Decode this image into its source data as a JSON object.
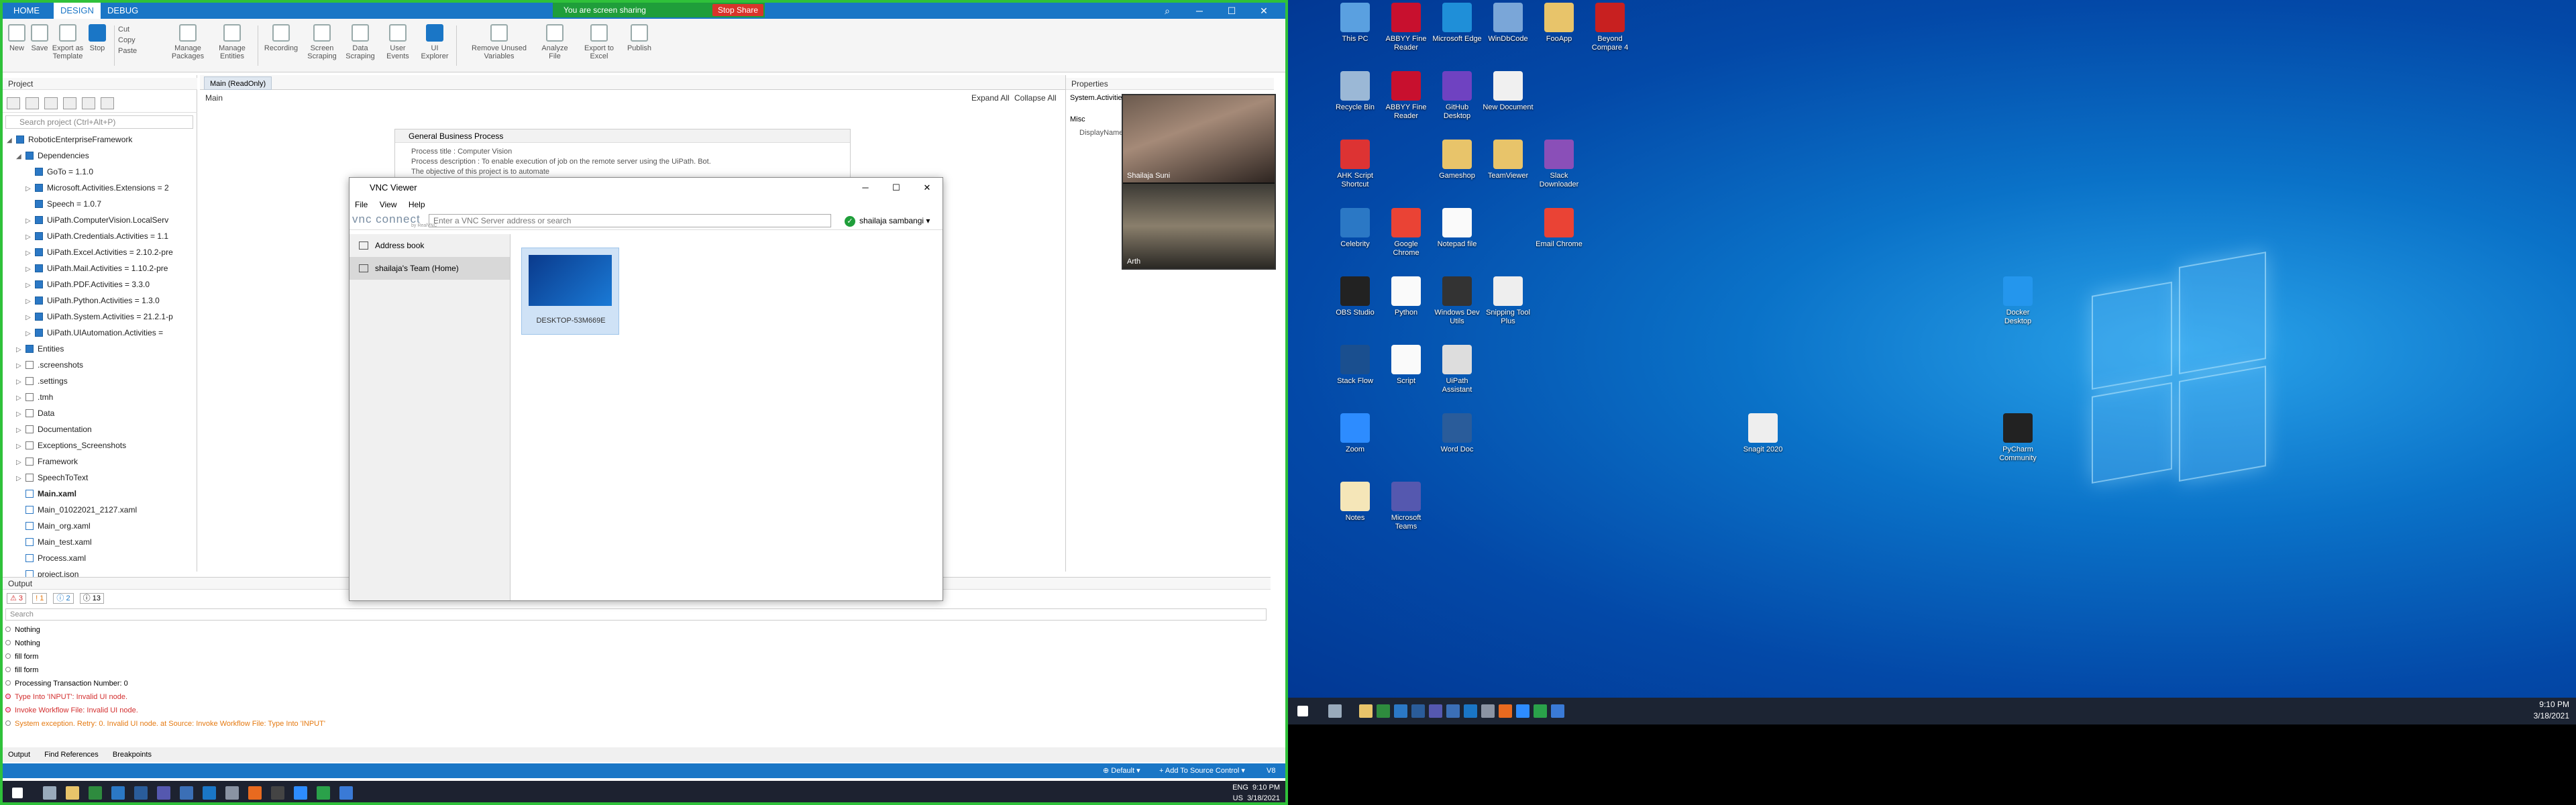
{
  "share": {
    "text": "You are screen sharing",
    "stop": "Stop Share"
  },
  "studio": {
    "tabs": [
      "HOME",
      "DESIGN",
      "DEBUG"
    ],
    "ribbon": [
      "New",
      "Save",
      "Export as Template",
      "Stop",
      "Cut",
      "Copy",
      "Paste",
      "Manage Packages",
      "Manage Entities",
      "Recording",
      "Screen Scraping",
      "Data Scraping",
      "User Events",
      "UI Explorer",
      "Remove Unused Variables",
      "Analyze File",
      "Export to Excel",
      "Publish"
    ],
    "project": {
      "title": "Project",
      "search": "Search project (Ctrl+Alt+P)",
      "tree": [
        {
          "label": "RoboticEnterpriseFramework",
          "level": 0,
          "type": "root",
          "exp": "◢"
        },
        {
          "label": "Dependencies",
          "level": 1,
          "type": "root",
          "exp": "◢"
        },
        {
          "label": "GoTo = 1.1.0",
          "level": 2,
          "type": "pkg",
          "exp": ""
        },
        {
          "label": "Microsoft.Activities.Extensions = 2",
          "level": 2,
          "type": "pkg",
          "exp": "▷"
        },
        {
          "label": "Speech = 1.0.7",
          "level": 2,
          "type": "pkg",
          "exp": ""
        },
        {
          "label": "UiPath.ComputerVision.LocalServ",
          "level": 2,
          "type": "pkg",
          "exp": "▷"
        },
        {
          "label": "UiPath.Credentials.Activities = 1.1",
          "level": 2,
          "type": "pkg",
          "exp": "▷"
        },
        {
          "label": "UiPath.Excel.Activities = 2.10.2-pre",
          "level": 2,
          "type": "pkg",
          "exp": "▷"
        },
        {
          "label": "UiPath.Mail.Activities = 1.10.2-pre",
          "level": 2,
          "type": "pkg",
          "exp": "▷"
        },
        {
          "label": "UiPath.PDF.Activities = 3.3.0",
          "level": 2,
          "type": "pkg",
          "exp": "▷"
        },
        {
          "label": "UiPath.Python.Activities = 1.3.0",
          "level": 2,
          "type": "pkg",
          "exp": "▷"
        },
        {
          "label": "UiPath.System.Activities = 21.2.1-p",
          "level": 2,
          "type": "pkg",
          "exp": "▷"
        },
        {
          "label": "UiPath.UIAutomation.Activities =",
          "level": 2,
          "type": "pkg",
          "exp": "▷"
        },
        {
          "label": "Entities",
          "level": 1,
          "type": "pkg",
          "exp": "▷"
        },
        {
          "label": ".screenshots",
          "level": 1,
          "type": "folder",
          "exp": "▷"
        },
        {
          "label": ".settings",
          "level": 1,
          "type": "folder",
          "exp": "▷"
        },
        {
          "label": ".tmh",
          "level": 1,
          "type": "folder",
          "exp": "▷"
        },
        {
          "label": "Data",
          "level": 1,
          "type": "folder",
          "exp": "▷"
        },
        {
          "label": "Documentation",
          "level": 1,
          "type": "folder",
          "exp": "▷"
        },
        {
          "label": "Exceptions_Screenshots",
          "level": 1,
          "type": "folder",
          "exp": "▷"
        },
        {
          "label": "Framework",
          "level": 1,
          "type": "folder",
          "exp": "▷"
        },
        {
          "label": "SpeechToText",
          "level": 1,
          "type": "folder",
          "exp": "▷"
        },
        {
          "label": "Main.xaml",
          "level": 1,
          "type": "file",
          "exp": "",
          "bold": true
        },
        {
          "label": "Main_01022021_2127.xaml",
          "level": 1,
          "type": "file",
          "exp": ""
        },
        {
          "label": "Main_org.xaml",
          "level": 1,
          "type": "file",
          "exp": ""
        },
        {
          "label": "Main_test.xaml",
          "level": 1,
          "type": "file",
          "exp": ""
        },
        {
          "label": "Process.xaml",
          "level": 1,
          "type": "file",
          "exp": ""
        },
        {
          "label": "project.json",
          "level": 1,
          "type": "file",
          "exp": ""
        }
      ]
    },
    "designer": {
      "tab": "Main (ReadOnly)",
      "breadcrumb": "Main",
      "expand": "Expand All",
      "collapse": "Collapse All",
      "activity_title": "General Business Process",
      "lines": [
        "Process title : Computer Vision",
        "Process description : To enable execution of job on the remote server using the UiPath. Bot.",
        "The objective of this project is to automate"
      ]
    },
    "properties": {
      "title": "Properties",
      "type": "System.Activities",
      "misc": "Misc",
      "display": "DisplayName"
    },
    "output": {
      "title": "Output",
      "errors": "⚠ 3",
      "warnings": "! 1",
      "info": "ⓘ 2",
      "trace": "ⓘ 13",
      "search": "Search",
      "lines": [
        {
          "text": "Nothing",
          "kind": "info"
        },
        {
          "text": "Nothing",
          "kind": "info"
        },
        {
          "text": "fill form",
          "kind": "info"
        },
        {
          "text": "fill form",
          "kind": "info"
        },
        {
          "text": "Processing Transaction Number: 0",
          "kind": "info"
        },
        {
          "text": "Type Into 'INPUT': Invalid UI node.",
          "kind": "err"
        },
        {
          "text": "Invoke Workflow File: Invalid UI node.",
          "kind": "err"
        },
        {
          "text": "System exception. Retry: 0. Invalid UI node. at Source: Invoke Workflow File: Type Into 'INPUT'",
          "kind": "warn"
        }
      ]
    },
    "bottom": [
      "Output",
      "Find References",
      "Breakpoints"
    ],
    "status": {
      "profile": "⊕ Default ▾",
      "source": "+ Add To Source Control ▾",
      "version": "V8"
    }
  },
  "vnc": {
    "title": "VNC Viewer",
    "menu": [
      "File",
      "View",
      "Help"
    ],
    "logo": "vnc connect",
    "logo_sub": "by RealVNC",
    "address_placeholder": "Enter a VNC Server address or search",
    "user": "shailaja sambangi",
    "side": [
      "Address book",
      "shailaja's Team (Home)"
    ],
    "computer": "DESKTOP-53M669E"
  },
  "zoom": {
    "p1": "Shailaja Suni",
    "p2": "Arth"
  },
  "desktop": {
    "icons": [
      {
        "label": "This PC",
        "color": "#5aa0e0",
        "col": 0,
        "row": 0
      },
      {
        "label": "ABBYY Fine Reader",
        "color": "#c8102e",
        "col": 1,
        "row": 0
      },
      {
        "label": "Microsoft Edge",
        "color": "#1f8fd8",
        "col": 2,
        "row": 0
      },
      {
        "label": "WinDbCode",
        "color": "#7aa6d8",
        "col": 3,
        "row": 0
      },
      {
        "label": "FooApp",
        "color": "#e8c46a",
        "col": 4,
        "row": 0
      },
      {
        "label": "Beyond Compare 4",
        "color": "#c82020",
        "col": 5,
        "row": 0
      },
      {
        "label": "Recycle Bin",
        "color": "#9bb8d6",
        "col": 0,
        "row": 1
      },
      {
        "label": "ABBYY Fine Reader",
        "color": "#c8102e",
        "col": 1,
        "row": 1
      },
      {
        "label": "GitHub Desktop",
        "color": "#6f42c1",
        "col": 2,
        "row": 1
      },
      {
        "label": "New Document",
        "color": "#f0f0f0",
        "col": 3,
        "row": 1
      },
      {
        "label": "AHK Script Shortcut",
        "color": "#d33",
        "col": 0,
        "row": 2
      },
      {
        "label": "Gameshop",
        "color": "#e8c46a",
        "col": 2,
        "row": 2
      },
      {
        "label": "TeamViewer",
        "color": "#e8c46a",
        "col": 3,
        "row": 2
      },
      {
        "label": "Slack Downloader",
        "color": "#8a4fb8",
        "col": 4,
        "row": 2
      },
      {
        "label": "Celebrity",
        "color": "#2b78c5",
        "col": 0,
        "row": 3
      },
      {
        "label": "Google Chrome",
        "color": "#ea4335",
        "col": 1,
        "row": 3
      },
      {
        "label": "Notepad file",
        "color": "#fafafa",
        "col": 2,
        "row": 3
      },
      {
        "label": "Email Chrome",
        "color": "#ea4335",
        "col": 4,
        "row": 3
      },
      {
        "label": "OBS Studio",
        "color": "#222",
        "col": 0,
        "row": 4
      },
      {
        "label": "Python",
        "color": "#fafafa",
        "col": 1,
        "row": 4
      },
      {
        "label": "Windows Dev Utils",
        "color": "#333",
        "col": 2,
        "row": 4
      },
      {
        "label": "Snipping Tool Plus",
        "color": "#eee",
        "col": 3,
        "row": 4
      },
      {
        "label": "Stack Flow",
        "color": "#1a4f8f",
        "col": 0,
        "row": 5
      },
      {
        "label": "Script",
        "color": "#fafafa",
        "col": 1,
        "row": 5
      },
      {
        "label": "UiPath Assistant",
        "color": "#ddd",
        "col": 2,
        "row": 5
      },
      {
        "label": "Zoom",
        "color": "#2d8cff",
        "col": 0,
        "row": 6
      },
      {
        "label": "Word Doc",
        "color": "#2a5c9a",
        "col": 2,
        "row": 6
      },
      {
        "label": "Notes",
        "color": "#f5e6b8",
        "col": 0,
        "row": 7
      },
      {
        "label": "Microsoft Teams",
        "color": "#5558af",
        "col": 1,
        "row": 7
      },
      {
        "label": "Docker Desktop",
        "color": "#2496ed",
        "col": 13,
        "row": 4
      },
      {
        "label": "Snagit 2020",
        "color": "#eee",
        "col": 8,
        "row": 6
      },
      {
        "label": "PyCharm Community",
        "color": "#222",
        "col": 13,
        "row": 6
      }
    ]
  },
  "tray": {
    "lang": "ENG",
    "region": "US",
    "time": "9:10 PM",
    "date": "3/18/2021"
  }
}
